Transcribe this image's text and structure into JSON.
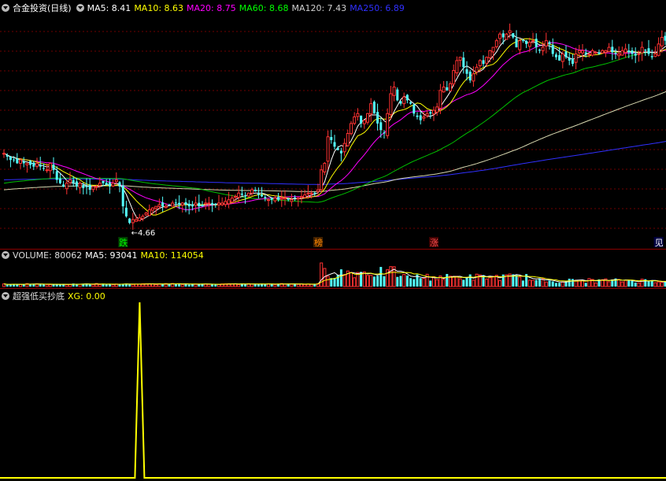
{
  "panels": {
    "price": {
      "stock_name": "合金投资(日线)",
      "indicators": [
        {
          "label": "MA5: 8.41",
          "color": "#ffffff"
        },
        {
          "label": "MA10: 8.63",
          "color": "#ffff00"
        },
        {
          "label": "MA20: 8.75",
          "color": "#ff00ff"
        },
        {
          "label": "MA60: 8.68",
          "color": "#00ff00"
        },
        {
          "label": "MA120: 7.43",
          "color": "#d0d0d0"
        },
        {
          "label": "MA250: 6.89",
          "color": "#3030ff"
        }
      ],
      "low_marker": "←4.66",
      "signals": [
        {
          "text": "跌",
          "color": "#00ff00",
          "bg": "#004000",
          "index": 36
        },
        {
          "text": "榜",
          "color": "#ff8800",
          "bg": "#402000",
          "index": 95
        },
        {
          "text": "涨",
          "color": "#ff5050",
          "bg": "#400000",
          "index": 130
        },
        {
          "text": "见",
          "color": "#ffffff",
          "bg": "#000040",
          "index": 198
        }
      ]
    },
    "volume": {
      "title": "VOLUME: 80062",
      "ma5": "MA5: 93041",
      "ma10": "MA10: 114054"
    },
    "indicator": {
      "title": "超强低买抄底",
      "xg": "XG: 0.00"
    }
  },
  "chart_data": {
    "type": "candlestick",
    "price_range": [
      4.3,
      11.0
    ],
    "low_price": 4.66,
    "closes": [
      6.8,
      6.7,
      6.6,
      6.6,
      6.5,
      6.6,
      6.5,
      6.5,
      6.45,
      6.4,
      6.5,
      6.4,
      6.35,
      6.3,
      6.5,
      6.3,
      6.0,
      5.9,
      5.8,
      5.9,
      6.0,
      5.9,
      5.8,
      5.9,
      5.75,
      5.8,
      5.7,
      5.8,
      5.8,
      5.9,
      5.9,
      5.85,
      5.8,
      5.9,
      6.0,
      5.8,
      5.2,
      4.9,
      4.7,
      4.8,
      4.8,
      4.85,
      4.9,
      5.0,
      5.1,
      5.15,
      5.2,
      5.25,
      5.2,
      5.2,
      5.25,
      5.3,
      5.3,
      5.25,
      5.3,
      5.25,
      5.2,
      5.2,
      5.3,
      5.2,
      5.2,
      5.3,
      5.3,
      5.25,
      5.25,
      5.3,
      5.3,
      5.35,
      5.4,
      5.45,
      5.5,
      5.6,
      5.55,
      5.5,
      5.6,
      5.7,
      5.65,
      5.55,
      5.5,
      5.45,
      5.4,
      5.4,
      5.45,
      5.4,
      5.45,
      5.45,
      5.4,
      5.4,
      5.45,
      5.45,
      5.5,
      5.55,
      5.6,
      5.6,
      5.6,
      5.7,
      6.3,
      6.5,
      7.3,
      7.2,
      7.0,
      6.9,
      6.8,
      7.1,
      7.4,
      7.7,
      7.9,
      8.0,
      7.7,
      7.8,
      8.0,
      8.3,
      8.0,
      7.7,
      7.5,
      7.4,
      8.0,
      8.6,
      8.8,
      8.4,
      8.3,
      8.5,
      8.4,
      8.3,
      8.0,
      7.9,
      7.8,
      7.9,
      8.0,
      8.0,
      8.1,
      8.2,
      8.7,
      8.8,
      8.7,
      8.9,
      9.3,
      9.6,
      9.7,
      9.4,
      9.2,
      9.0,
      9.2,
      9.4,
      9.6,
      9.5,
      9.7,
      9.9,
      10.0,
      10.2,
      10.4,
      10.3,
      10.4,
      10.5,
      10.3,
      10.0,
      10.2,
      10.2,
      10.1,
      10.15,
      10.2,
      10.0,
      9.9,
      10.0,
      10.2,
      10.1,
      9.8,
      9.7,
      9.6,
      9.8,
      9.7,
      9.6,
      9.5,
      9.8,
      9.9,
      9.9,
      9.8,
      9.8,
      9.9,
      9.85,
      9.8,
      9.9,
      9.9,
      10.0,
      9.85,
      9.8,
      9.8,
      9.9,
      9.95,
      9.85,
      9.8,
      9.75,
      9.8,
      10.0,
      9.9,
      9.8,
      9.7,
      9.8,
      10.1,
      10.3,
      10.2,
      9.95,
      10.2
    ]
  }
}
